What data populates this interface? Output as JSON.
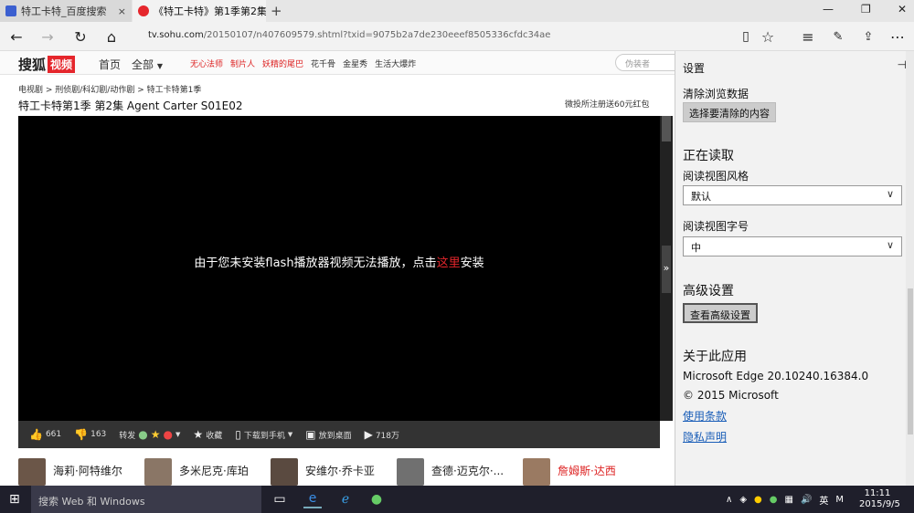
{
  "tabs": [
    {
      "title": "特工卡特_百度搜索",
      "close": "×"
    },
    {
      "title": "《特工卡特》第1季第2集",
      "close": "×"
    }
  ],
  "new_tab": "+",
  "window_controls": {
    "minimize": "—",
    "maximize": "❐",
    "close": "✕"
  },
  "address": {
    "domain": "tv.sohu.com",
    "path": "/20150107/n407609579.shtml?txid=9075b2a7de230eeef8505336cfdc34ae"
  },
  "site": {
    "logo_text": "搜狐",
    "logo_badge": "视频",
    "nav": [
      "首页",
      "全部"
    ],
    "hot": [
      {
        "label": "无心法师",
        "red": true
      },
      {
        "label": "制片人",
        "red": true
      },
      {
        "label": "妖精的尾巴",
        "red": true
      },
      {
        "label": "花千骨",
        "red": false
      },
      {
        "label": "金星秀",
        "red": false
      },
      {
        "label": "生活大爆炸",
        "red": false
      }
    ],
    "search_placeholder": "伪装者"
  },
  "breadcrumb": "电视剧 > 刑侦剧/科幻剧/动作剧 > 特工卡特第1季",
  "video_title": "特工卡特第1季 第2集 Agent Carter S01E02",
  "promo": "微投所注册送60元红包",
  "player": {
    "msg_before": "由于您未安装flash播放器视频无法播放，点击",
    "msg_link": "这里",
    "msg_after": "安装"
  },
  "controls": {
    "likes": "661",
    "dislikes": "163",
    "share": "转发",
    "favorite": "收藏",
    "download": "下载到手机",
    "desktop": "放到桌面",
    "plays": "718万"
  },
  "cast": [
    {
      "name": "海莉·阿特维尔",
      "red": false
    },
    {
      "name": "多米尼克·库珀",
      "red": false
    },
    {
      "name": "安维尔·乔卡亚",
      "red": false
    },
    {
      "name": "查德·迈克尔·...",
      "red": false
    },
    {
      "name": "詹姆斯·达西",
      "red": true
    }
  ],
  "settings": {
    "title": "设置",
    "clear_label": "清除浏览数据",
    "clear_button": "选择要清除的内容",
    "reading_heading": "正在读取",
    "reading_style_label": "阅读视图风格",
    "reading_style_value": "默认",
    "reading_font_label": "阅读视图字号",
    "reading_font_value": "中",
    "advanced_heading": "高级设置",
    "advanced_button": "查看高级设置",
    "about_heading": "关于此应用",
    "version": "Microsoft Edge 20.10240.16384.0",
    "copyright": "© 2015 Microsoft",
    "terms_link": "使用条款",
    "privacy_link": "隐私声明"
  },
  "taskbar": {
    "search_text": "搜索 Web 和 Windows",
    "ime": "英",
    "ime2": "M",
    "time": "11:11",
    "date": "2015/9/5"
  }
}
